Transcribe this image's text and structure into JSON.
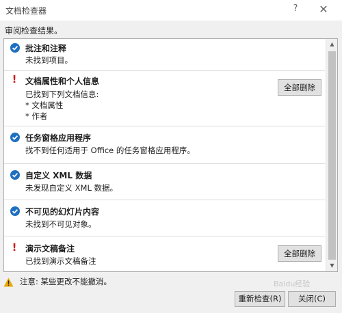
{
  "window": {
    "title": "文档检查器",
    "help_glyph": "?",
    "close_glyph": "✕"
  },
  "subtitle": "审阅检查结果。",
  "results": [
    {
      "status": "ok",
      "title": "批注和注释",
      "details": [
        "未找到项目。"
      ]
    },
    {
      "status": "warning",
      "title": "文档属性和个人信息",
      "details": [
        "已找到下列文档信息:",
        "* 文档属性",
        "* 作者"
      ],
      "button": "全部删除"
    },
    {
      "status": "ok",
      "title": "任务窗格应用程序",
      "details": [
        "找不到任何适用于 Office 的任务窗格应用程序。"
      ]
    },
    {
      "status": "ok",
      "title": "自定义 XML 数据",
      "details": [
        "未发现自定义 XML 数据。"
      ]
    },
    {
      "status": "ok",
      "title": "不可见的幻灯片内容",
      "details": [
        "未找到不可见对象。"
      ]
    },
    {
      "status": "warning",
      "title": "演示文稿备注",
      "details": [
        "已找到演示文稿备注"
      ],
      "button": "全部删除"
    }
  ],
  "footer": {
    "warning_text": "注意: 某些更改不能撤消。",
    "reinspect_label": "重新检查(R)",
    "close_label": "关闭(C)"
  },
  "watermark": "Baidu经验",
  "colors": {
    "ok_icon": "#1f6fbf",
    "warning_mark": "#c5221f",
    "caution_icon": "#e8a800"
  }
}
